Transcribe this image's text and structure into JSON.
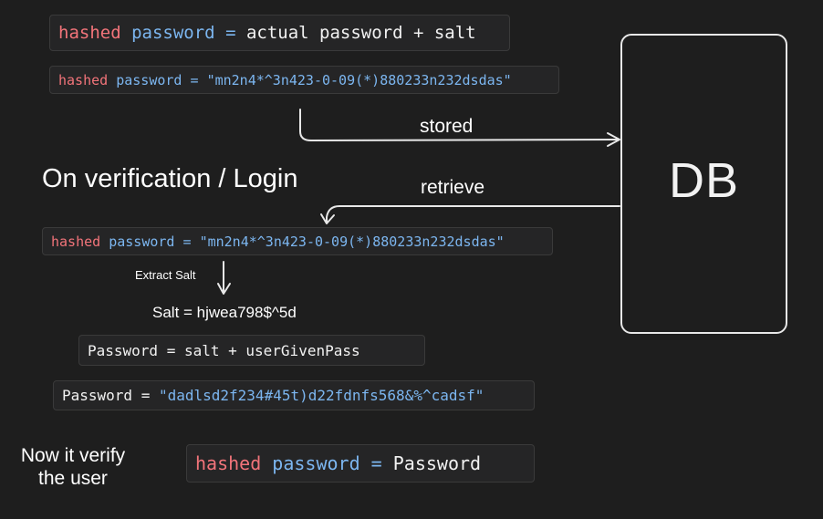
{
  "formula": {
    "hashed": "hashed",
    "password": "password",
    "equals": "=",
    "rhs": "actual password + salt"
  },
  "stored_hash": {
    "hashed": "hashed",
    "password": "password",
    "equals": "=",
    "value": "\"mn2n4*^3n423-0-09(*)880233n232dsdas\""
  },
  "arrow_labels": {
    "stored": "stored",
    "retrieve": "retrieve",
    "extract_salt": "Extract Salt"
  },
  "db": {
    "label": "DB"
  },
  "verification": {
    "heading": "On verification / Login",
    "retrieved_hash": {
      "hashed": "hashed",
      "password": "password",
      "equals": "=",
      "value": "\"mn2n4*^3n423-0-09(*)880233n232dsdas\""
    },
    "salt_line": "Salt = hjwea798$^5d",
    "password_formula": "Password = salt + userGivenPass",
    "password_value_label": "Password =",
    "password_value": "\"dadlsd2f234#45t)d22fdnfs568&%^cadsf\"",
    "verify_note_line1": "Now it verify",
    "verify_note_line2": "the user",
    "final_compare": {
      "hashed": "hashed",
      "password": "password",
      "equals": "=",
      "rhs": "Password"
    }
  }
}
